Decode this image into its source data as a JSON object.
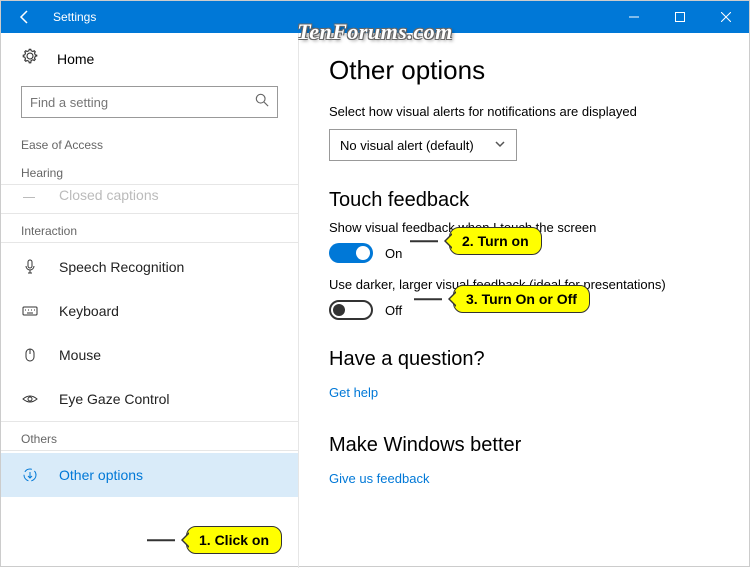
{
  "titlebar": {
    "title": "Settings"
  },
  "watermark": "TenForums.com",
  "sidebar": {
    "home": "Home",
    "search_placeholder": "Find a setting",
    "category": "Ease of Access",
    "group_hearing": "Hearing",
    "closed_captions": "Closed captions",
    "group_interaction": "Interaction",
    "items": {
      "speech": "Speech Recognition",
      "keyboard": "Keyboard",
      "mouse": "Mouse",
      "eyegaze": "Eye Gaze Control"
    },
    "group_others": "Others",
    "other_options": "Other options"
  },
  "main": {
    "title": "Other options",
    "visual_alerts_label": "Select how visual alerts for notifications are displayed",
    "visual_alerts_value": "No visual alert (default)",
    "touch_feedback_title": "Touch feedback",
    "touch_feedback_label1": "Show visual feedback when I touch the screen",
    "toggle1_state": "On",
    "touch_feedback_label2": "Use darker, larger visual feedback (ideal for presentations)",
    "toggle2_state": "Off",
    "question_title": "Have a question?",
    "get_help": "Get help",
    "better_title": "Make Windows better",
    "feedback": "Give us feedback"
  },
  "callouts": {
    "c1": "1. Click on",
    "c2": "2. Turn on",
    "c3": "3. Turn On or Off"
  }
}
